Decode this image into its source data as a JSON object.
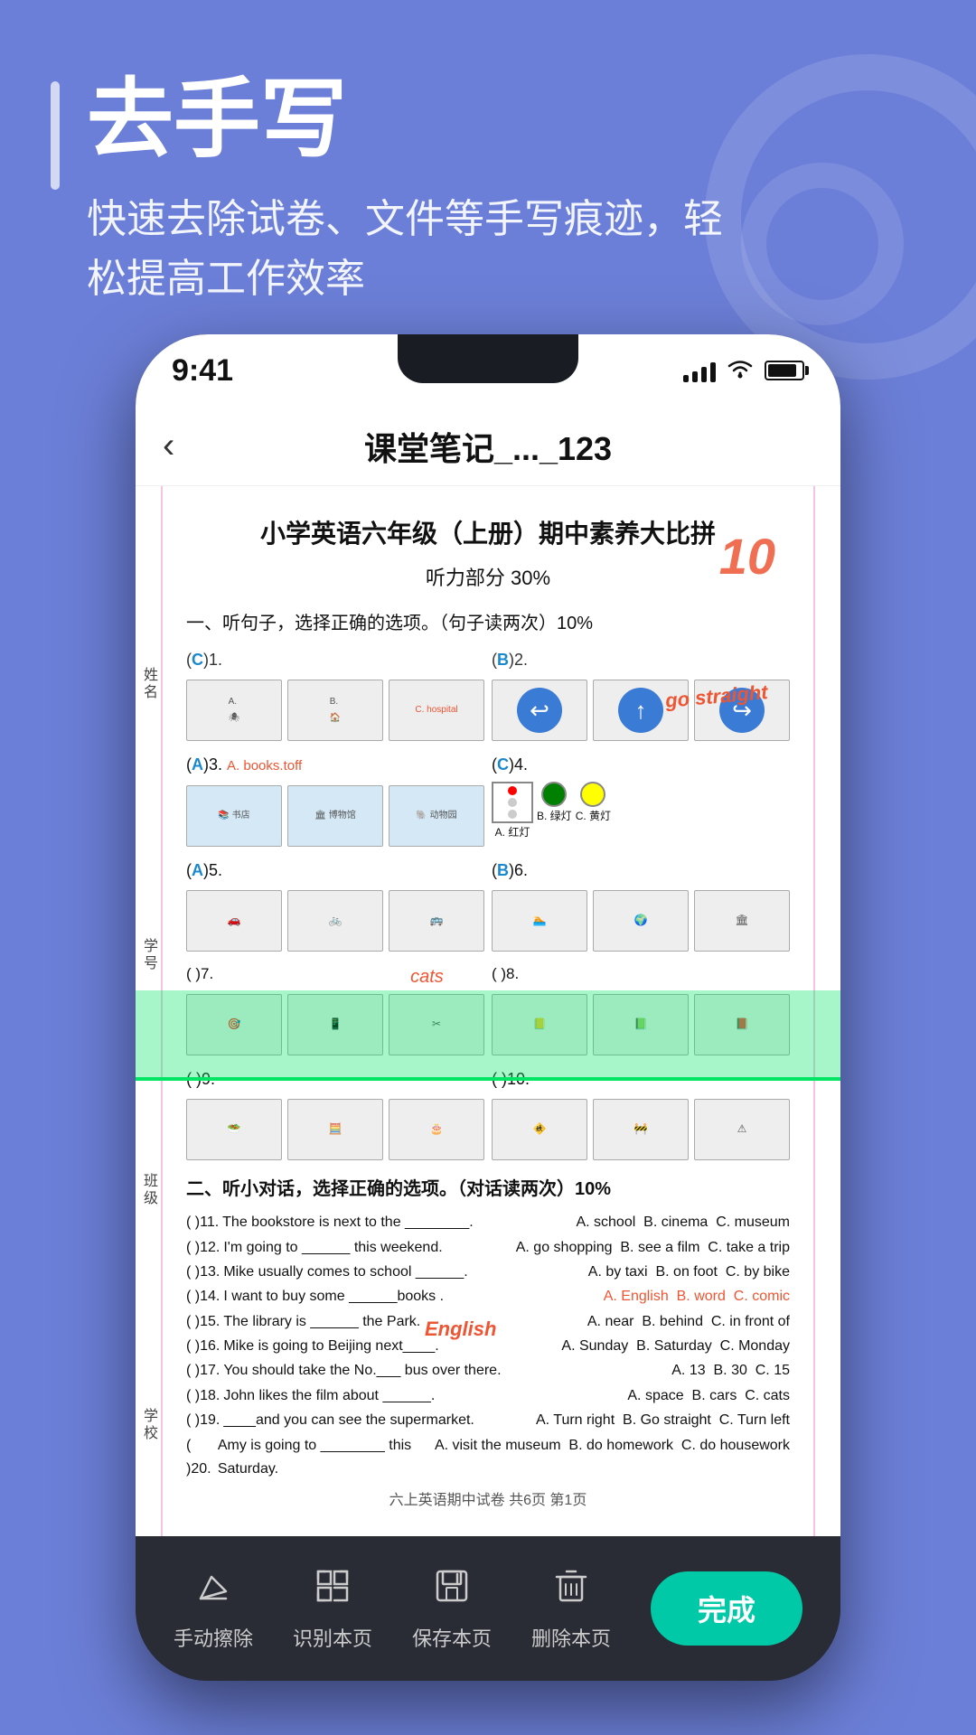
{
  "promo": {
    "title": "去手写",
    "subtitle": "快速去除试卷、文件等手写痕迹，轻\n松提高工作效率"
  },
  "statusBar": {
    "time": "9:41"
  },
  "navBar": {
    "backIcon": "‹",
    "title": "课堂笔记_..._123"
  },
  "document": {
    "title": "小学英语六年级（上册）期中素养大比拼",
    "subtitle": "听力部分 30%",
    "section1": "一、听句子，选择正确的选项。（句子读两次）10%",
    "listeningRows": [
      {
        "num": "( C )1.",
        "options": []
      },
      {
        "num": "( B )2.",
        "options": []
      },
      {
        "num": "( A )3.",
        "options": []
      },
      {
        "num": "( C )4.",
        "options": [
          "A. 红灯",
          "B. 绿灯",
          "C. 黄灯"
        ]
      },
      {
        "num": "( A )5.",
        "options": []
      },
      {
        "num": "( B )6.",
        "options": []
      },
      {
        "num": "( )7.",
        "options": []
      },
      {
        "num": "( )8.",
        "options": []
      },
      {
        "num": "( )9.",
        "options": []
      },
      {
        "num": "( )10.",
        "options": []
      }
    ],
    "section2": "二、听小对话，选择正确的选项。（对话读两次）10%",
    "dialogRows": [
      {
        "num": "( )11.",
        "text": "The bookstore is next to the ________.",
        "a": "A. school",
        "b": "B. cinema",
        "c": "C. museum"
      },
      {
        "num": "( )12.",
        "text": "I'm going to ______ this weekend.",
        "a": "A. go shopping",
        "b": "B. see a film",
        "c": "C. take a trip"
      },
      {
        "num": "( )13.",
        "text": "Mike usually comes to school ______.",
        "a": "A. by taxi",
        "b": "B. on foot",
        "c": "C. by bike"
      },
      {
        "num": "( )14.",
        "text": "I want to buy some ______books.",
        "a": "A. English",
        "b": "B. word",
        "c": "C. comic"
      },
      {
        "num": "( )15.",
        "text": "The library is ______ the Park.",
        "a": "A. near",
        "b": "B. behind",
        "c": "C. in front of"
      },
      {
        "num": "( )16.",
        "text": "Mike is going to Beijing next____.",
        "a": "A. Sunday",
        "b": "B. Saturday",
        "c": "C. Monday"
      },
      {
        "num": "( )17.",
        "text": "You should take the No.___ bus over there.",
        "a": "A. 13",
        "b": "B. 30",
        "c": "C. 15"
      },
      {
        "num": "( )18.",
        "text": "John likes the film about ______.",
        "a": "A. space",
        "b": "B. cars",
        "c": "C. cats"
      },
      {
        "num": "( )19.",
        "text": "____and you can see the supermarket.",
        "a": "A. Turn right",
        "b": "B. Go straight",
        "c": "C. Turn left"
      },
      {
        "num": "( )20.",
        "text": "Amy is going to ________ this Saturday.",
        "a": "A. visit the museum",
        "b": "B. do homework",
        "c": "C. do housework"
      }
    ],
    "footer": "六上英语期中试卷  共6页  第1页",
    "handwritingLabel": "English"
  },
  "toolbar": {
    "items": [
      {
        "id": "manual-erase",
        "icon": "◇",
        "label": "手动擦除"
      },
      {
        "id": "recognize-page",
        "icon": "⬡",
        "label": "识别本页"
      },
      {
        "id": "save-page",
        "icon": "💾",
        "label": "保存本页"
      },
      {
        "id": "delete-page",
        "icon": "🗑",
        "label": "删除本页"
      }
    ],
    "doneButton": "完成"
  }
}
